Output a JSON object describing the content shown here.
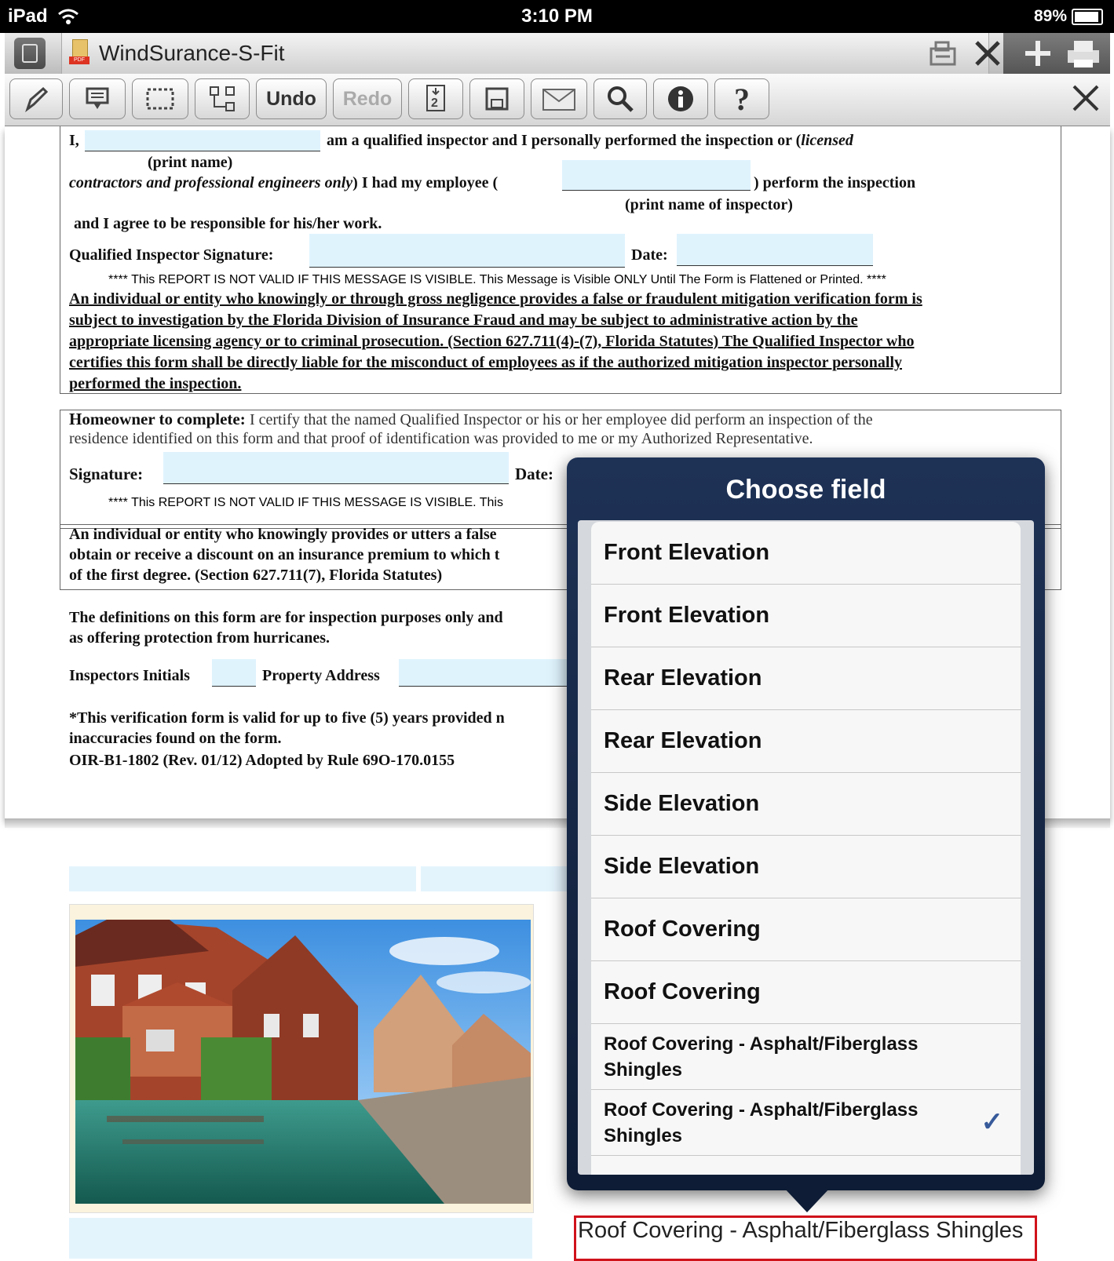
{
  "status_bar": {
    "device": "iPad",
    "time": "3:10 PM",
    "battery": "89%"
  },
  "title_bar": {
    "app_title": "WindSurance-S-Fit"
  },
  "toolbar": {
    "undo_label": "Undo",
    "redo_label": "Redo",
    "help_label": "?"
  },
  "form": {
    "line1_prefix": "I,",
    "line1_text": "am a qualified inspector and I personally performed the inspection or (",
    "line1_italic": "licensed",
    "print_name": "(print name)",
    "line2_italic": "contractors and professional engineers only",
    "line2_text": ") I had my employee (",
    "line2_end": ") perform the inspection",
    "print_name_inspector": "(print name of inspector)",
    "line3": "and I agree to be responsible for his/her work.",
    "qi_signature_label": "Qualified Inspector Signature:",
    "date_label": "Date:",
    "not_valid_msg": "**** This REPORT IS NOT VALID IF THIS MESSAGE IS VISIBLE. This Message is Visible ONLY Until The Form is Flattened or Printed. ****",
    "warning_lines": [
      "An individual or entity who knowingly or through gross negligence provides a false or fraudulent mitigation verification form is",
      "subject to investigation by the Florida Division of Insurance Fraud and may be subject to administrative action by the",
      "appropriate licensing agency or to criminal prosecution. (Section 627.711(4)-(7), Florida Statutes) The Qualified Inspector who",
      "certifies this form shall be directly liable for the misconduct of employees as if the authorized mitigation inspector personally",
      "performed the inspection."
    ],
    "homeowner_label": "Homeowner to complete:",
    "homeowner_text_1": "I certify that the named Qualified Inspector or his or her employee did perform an inspection of the",
    "homeowner_text_2": "residence identified on this form and that proof of identification was provided to me or my Authorized Representative.",
    "signature_label": "Signature:",
    "date_label_2": "Date:",
    "not_valid_msg_2": "**** This REPORT IS NOT VALID IF THIS MESSAGE IS VISIBLE. This",
    "fraud_lines": [
      "An individual or entity who knowingly provides or utters a false",
      "obtain or receive a discount on an insurance premium to which t",
      "of the first degree. (Section 627.711(7), Florida Statutes)"
    ],
    "definitions_lines": [
      "The definitions on this form are for inspection purposes only and",
      "as offering protection from hurricanes."
    ],
    "inspectors_initials_label": "Inspectors Initials",
    "property_address_label": "Property Address",
    "validity_lines": [
      "*This verification form is valid for up to five (5) years provided n",
      "inaccuracies found on the form."
    ],
    "form_id": "OIR-B1-1802 (Rev. 01/12) Adopted by Rule 69O-170.0155"
  },
  "popover": {
    "title": "Choose field",
    "items": [
      {
        "label": "Front Elevation",
        "checked": false
      },
      {
        "label": "Front Elevation",
        "checked": false
      },
      {
        "label": "Rear Elevation",
        "checked": false
      },
      {
        "label": "Rear Elevation",
        "checked": false
      },
      {
        "label": "Side Elevation",
        "checked": false
      },
      {
        "label": "Side Elevation",
        "checked": false
      },
      {
        "label": "Roof Covering",
        "checked": false
      },
      {
        "label": "Roof Covering",
        "checked": false
      },
      {
        "label": "Roof Covering - Asphalt/Fiberglass Shingles",
        "checked": false
      },
      {
        "label": "Roof Covering - Asphalt/Fiberglass Shingles",
        "checked": true
      }
    ],
    "check_glyph": "✓"
  },
  "selected_field": {
    "value": "Roof Covering - Asphalt/Fiberglass Shingles"
  },
  "colors": {
    "highlight_border": "#d0121b",
    "popover_bg": "#0e1c35",
    "field_bg": "#dff3fd"
  }
}
